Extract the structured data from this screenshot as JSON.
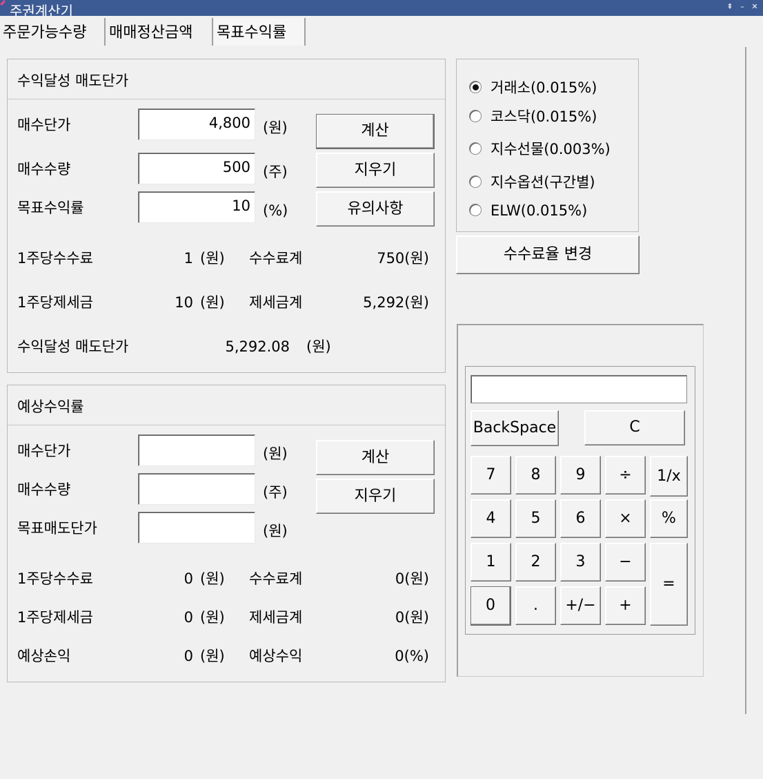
{
  "window": {
    "title": "주권계산기"
  },
  "tabs": [
    "주문가능수량",
    "매매정산금액",
    "목표수익률"
  ],
  "sell_price": {
    "title": "수익달성 매도단가",
    "fields": [
      {
        "label": "매수단가",
        "value": "4,800",
        "unit": "(원)"
      },
      {
        "label": "매수수량",
        "value": "500",
        "unit": "(주)"
      },
      {
        "label": "목표수익률",
        "value": "10",
        "unit": "(%)"
      }
    ],
    "buttons": [
      "계산",
      "지우기",
      "유의사항"
    ],
    "results": {
      "fee_per_share_label": "1주당수수료",
      "fee_per_share_value": "1",
      "fee_per_share_unit": "(원)",
      "fee_total_label": "수수료계",
      "fee_total_value": "750(원)",
      "tax_per_share_label": "1주당제세금",
      "tax_per_share_value": "10",
      "tax_per_share_unit": "(원)",
      "tax_total_label": "제세금계",
      "tax_total_value": "5,292(원)",
      "target_label": "수익달성 매도단가",
      "target_value": "5,292.08",
      "target_unit": "(원)"
    }
  },
  "expected": {
    "title": "예상수익률",
    "fields": [
      {
        "label": "매수단가",
        "value": "",
        "unit": "(원)"
      },
      {
        "label": "매수수량",
        "value": "",
        "unit": "(주)"
      },
      {
        "label": "목표매도단가",
        "value": "",
        "unit": "(원)"
      }
    ],
    "buttons": [
      "계산",
      "지우기"
    ],
    "results": {
      "fee_per_share_label": "1주당수수료",
      "fee_per_share_value": "0",
      "fee_per_share_unit": "(원)",
      "fee_total_label": "수수료계",
      "fee_total_value": "0(원)",
      "tax_per_share_label": "1주당제세금",
      "tax_per_share_value": "0",
      "tax_per_share_unit": "(원)",
      "tax_total_label": "제세금계",
      "tax_total_value": "0(원)",
      "pl_label": "예상손익",
      "pl_value": "0",
      "pl_unit": "(원)",
      "rate_label": "예상수익",
      "rate_value": "0(%)"
    }
  },
  "markets": {
    "options": [
      {
        "label": "거래소(0.015%)",
        "selected": true
      },
      {
        "label": "코스닥(0.015%)",
        "selected": false
      },
      {
        "label": "지수선물(0.003%)",
        "selected": false
      },
      {
        "label": "지수옵션(구간별)",
        "selected": false
      },
      {
        "label": "ELW(0.015%)",
        "selected": false
      }
    ],
    "change_button": "수수료율 변경"
  },
  "calculator": {
    "display": "",
    "backspace": "BackSpace",
    "clear": "C",
    "keys": [
      "7",
      "8",
      "9",
      "÷",
      "1/x",
      "4",
      "5",
      "6",
      "×",
      "%",
      "1",
      "2",
      "3",
      "−",
      "=",
      "0",
      ".",
      "+/−",
      "+"
    ]
  },
  "colors": {
    "titlebar": "#3c5a93",
    "background": "#f0f0f0"
  }
}
